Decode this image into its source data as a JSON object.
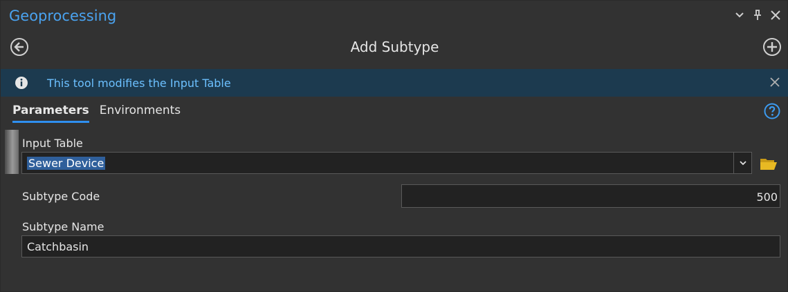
{
  "pane": {
    "title": "Geoprocessing",
    "icons": [
      "chevron-down-icon",
      "pin-icon",
      "close-icon"
    ]
  },
  "tool": {
    "title": "Add Subtype",
    "back_icon": "back-arrow-icon",
    "add_icon": "plus-circle-icon"
  },
  "banner": {
    "icon": "info-icon",
    "text": "This tool modifies the Input Table",
    "close_icon": "close-icon"
  },
  "tabs": [
    {
      "label": "Parameters",
      "active": true
    },
    {
      "label": "Environments",
      "active": false
    }
  ],
  "help_icon": "help-icon",
  "params": {
    "input_table": {
      "label": "Input Table",
      "value": "Sewer Device"
    },
    "subtype_code": {
      "label": "Subtype Code",
      "value": "500"
    },
    "subtype_name": {
      "label": "Subtype Name",
      "value": "Catchbasin"
    }
  },
  "colors": {
    "accent": "#4aa3f0",
    "banner_bg": "#1c3a4f",
    "banner_text": "#6cc0ff",
    "tab_underline": "#2f8ff0",
    "panel_bg": "#323232",
    "field_bg": "#222222",
    "selection": "#2f5f9b",
    "folder": "#e8b923"
  }
}
